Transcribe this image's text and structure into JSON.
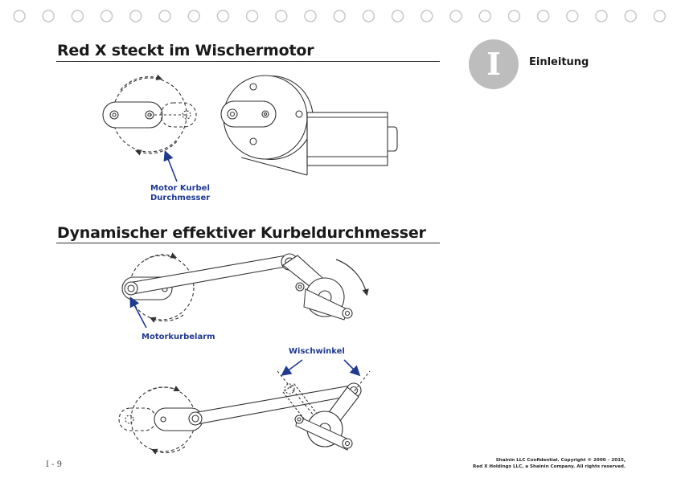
{
  "section1": {
    "title": "Red X steckt im Wischermotor"
  },
  "section2": {
    "title": "Dynamischer effektiver Kurbeldurchmesser"
  },
  "chapter": {
    "letter": "I",
    "title": "Einleitung"
  },
  "labels": {
    "crank_diameter_line1": "Motor Kurbel",
    "crank_diameter_line2": "Durchmesser",
    "crank_arm": "Motorkurbelarm",
    "wipe_angle": "Wischwinkel"
  },
  "footer": {
    "page_number": "I - 9",
    "line1": "Shainin LLC Confidential. Copyright © 2000 – 2015,",
    "line2": "Red X Holdings LLC, a Shainin Company. All rights reserved."
  },
  "colors": {
    "label_blue": "#1f3a8f",
    "badge_gray": "#bdbdbd"
  }
}
